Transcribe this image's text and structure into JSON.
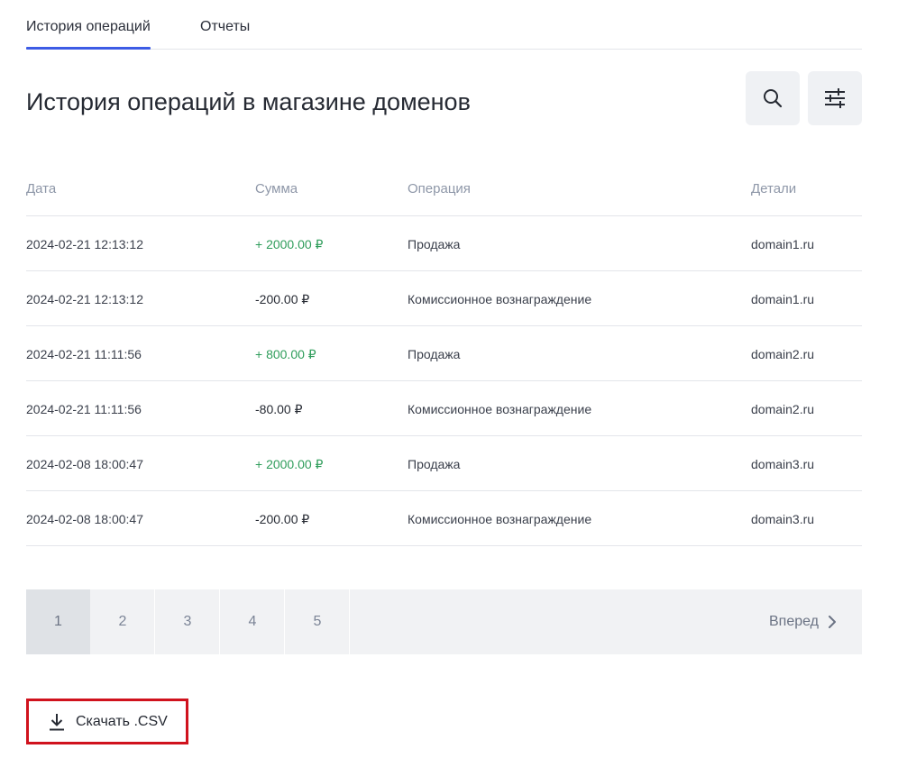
{
  "tabs": [
    {
      "label": "История операций",
      "active": true
    },
    {
      "label": "Отчеты",
      "active": false
    }
  ],
  "page_title": "История операций в магазине доменов",
  "toolbar": {
    "search_icon": "search-icon",
    "filter_icon": "sliders-icon"
  },
  "table": {
    "headers": {
      "date": "Дата",
      "sum": "Сумма",
      "operation": "Операция",
      "details": "Детали"
    },
    "rows": [
      {
        "date": "2024-02-21 12:13:12",
        "sum": "+ 2000.00 ₽",
        "type": "positive",
        "operation": "Продажа",
        "details": "domain1.ru"
      },
      {
        "date": "2024-02-21 12:13:12",
        "sum": "-200.00 ₽",
        "type": "negative",
        "operation": "Комиссионное вознаграждение",
        "details": "domain1.ru"
      },
      {
        "date": "2024-02-21 11:11:56",
        "sum": "+ 800.00 ₽",
        "type": "positive",
        "operation": "Продажа",
        "details": "domain2.ru"
      },
      {
        "date": "2024-02-21 11:11:56",
        "sum": "-80.00 ₽",
        "type": "negative",
        "operation": "Комиссионное вознаграждение",
        "details": "domain2.ru"
      },
      {
        "date": "2024-02-08 18:00:47",
        "sum": "+ 2000.00 ₽",
        "type": "positive",
        "operation": "Продажа",
        "details": "domain3.ru"
      },
      {
        "date": "2024-02-08 18:00:47",
        "sum": "-200.00 ₽",
        "type": "negative",
        "operation": "Комиссионное вознаграждение",
        "details": "domain3.ru"
      }
    ]
  },
  "colors": {
    "positive": "#2f9d5b",
    "accent": "#3d5ce5",
    "highlight_border": "#d0121d"
  },
  "pagination": {
    "pages": [
      "1",
      "2",
      "3",
      "4",
      "5"
    ],
    "current": "1",
    "next_label": "Вперед"
  },
  "download": {
    "label": "Скачать .CSV",
    "icon": "download-icon"
  }
}
